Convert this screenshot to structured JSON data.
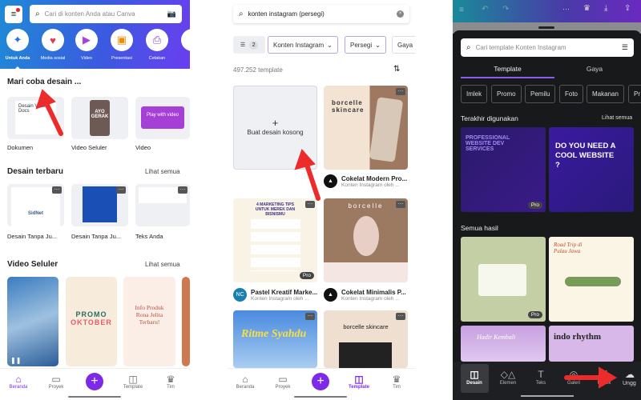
{
  "home": {
    "search_placeholder": "Cari di konten Anda atau Canva",
    "categories": [
      {
        "label": "Untuk Anda",
        "icon": "sparkle-icon"
      },
      {
        "label": "Media sosial",
        "icon": "heart-icon"
      },
      {
        "label": "Video",
        "icon": "video-icon"
      },
      {
        "label": "Presentasi",
        "icon": "presentation-icon"
      },
      {
        "label": "Cetakan",
        "icon": "printer-icon"
      }
    ],
    "try_title": "Mari coba desain ...",
    "try_items": [
      "Dokumen",
      "Video Seluler",
      "Video"
    ],
    "try_thumbs": {
      "doc": "Desain Visual Docs",
      "ayo": "AYO GERAK",
      "play": "Play with video"
    },
    "recent_title": "Desain terbaru",
    "recent_link": "Lihat semua",
    "recent_items": [
      "Desain Tanpa Ju...",
      "Desain Tanpa Ju...",
      "Teks Anda"
    ],
    "sidnet": "SidNet",
    "video_title": "Video Seluler",
    "video_link": "Lihat semua",
    "promo": [
      "PROMO",
      "OKTOBER"
    ],
    "info": "Info Produk Rona Jelita Terbaru!",
    "nav": [
      "Beranda",
      "Proyek",
      "Template",
      "Tim"
    ],
    "active_nav": "Beranda"
  },
  "templates": {
    "search_value": "konten instagram (persegi)",
    "filter_count": "2",
    "filters": [
      "Konten Instagram",
      "Persegi",
      "Gaya"
    ],
    "count": "497.252 template",
    "blank": "Buat desain kosong",
    "items": [
      {
        "name": "Cokelat Modern Pro...",
        "sub": "Konten Instagram oleh ...",
        "thumb": "borcelle skincare"
      },
      {
        "name": "Pastel Kreatif Marke...",
        "sub": "Konten Instagram oleh ...",
        "avatar": "NC",
        "thumb": "4 MARKETING TIPS UNTUK MEREK DAN BISNISMU",
        "pro": "Pro"
      },
      {
        "name": "Cokelat Minimalis P...",
        "sub": "Konten Instagram oleh ...",
        "thumb": "borcelle"
      },
      {
        "thumb": "Ritme Syahdu"
      },
      {
        "thumb": "borcelle skincare"
      }
    ],
    "nav": [
      "Beranda",
      "Proyek",
      "Template",
      "Tim"
    ],
    "active_nav": "Template"
  },
  "editor": {
    "search_placeholder": "Cari template Konten Instagram",
    "tabs": [
      "Template",
      "Gaya"
    ],
    "active_tab": "Template",
    "chips": [
      "Imlek",
      "Promo",
      "Pemilu",
      "Foto",
      "Makanan",
      "Pr"
    ],
    "recent_title": "Terakhir digunakan",
    "recent_link": "Lihat semua",
    "recent_thumbs": [
      "PROFESSIONAL WEBSITE DEV SERVICES",
      "DO YOU NEED A COOL WEBSITE ?"
    ],
    "all_title": "Semua hasil",
    "pro": "Pro",
    "all_thumbs": [
      "Road Trip di Pulau Jawa",
      "Hadir Kembali",
      "indo rhythm"
    ],
    "nav": [
      "Desain",
      "Elemen",
      "Teks",
      "Galeri",
      "Merek",
      "Ungg"
    ],
    "active_nav": "Desain"
  },
  "colors": {
    "brand": "#7d2ae8",
    "annotation_arrow": "#ee2b2b"
  }
}
